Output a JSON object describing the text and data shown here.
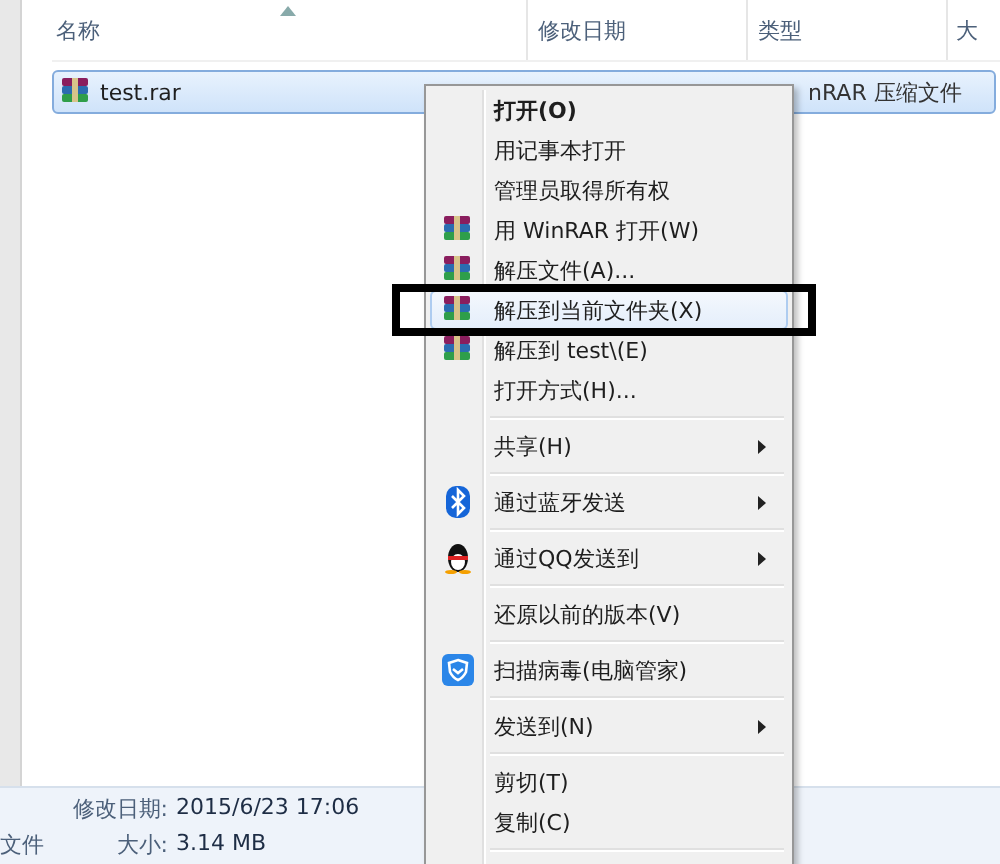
{
  "columns": [
    {
      "label": "名称",
      "sorted": true
    },
    {
      "label": "修改日期",
      "sorted": false
    },
    {
      "label": "类型",
      "sorted": false
    },
    {
      "label": "大",
      "sorted": false
    }
  ],
  "files": [
    {
      "name": "test.rar",
      "type": "nRAR 压缩文件",
      "selected": true
    }
  ],
  "context_menu": [
    {
      "kind": "item",
      "label": "打开(O)",
      "bold": true,
      "submenu": false,
      "selected": false
    },
    {
      "kind": "item",
      "label": "用记事本打开",
      "bold": false,
      "submenu": false,
      "selected": false
    },
    {
      "kind": "item",
      "label": "管理员取得所有权",
      "bold": false,
      "submenu": false,
      "selected": false
    },
    {
      "kind": "winrar",
      "label": "用 WinRAR 打开(W)",
      "bold": false,
      "submenu": false,
      "selected": false
    },
    {
      "kind": "winrar",
      "label": "解压文件(A)...",
      "bold": false,
      "submenu": false,
      "selected": false
    },
    {
      "kind": "winrar",
      "label": "解压到当前文件夹(X)",
      "bold": false,
      "submenu": false,
      "selected": true
    },
    {
      "kind": "winrar",
      "label": "解压到 test\\(E)",
      "bold": false,
      "submenu": false,
      "selected": false
    },
    {
      "kind": "item",
      "label": "打开方式(H)...",
      "bold": false,
      "submenu": false,
      "selected": false
    },
    {
      "kind": "separator"
    },
    {
      "kind": "item",
      "label": "共享(H)",
      "bold": false,
      "submenu": true,
      "selected": false
    },
    {
      "kind": "separator"
    },
    {
      "kind": "bluetooth",
      "label": "通过蓝牙发送",
      "bold": false,
      "submenu": true,
      "selected": false
    },
    {
      "kind": "separator"
    },
    {
      "kind": "qq",
      "label": "通过QQ发送到",
      "bold": false,
      "submenu": true,
      "selected": false
    },
    {
      "kind": "separator"
    },
    {
      "kind": "item",
      "label": "还原以前的版本(V)",
      "bold": false,
      "submenu": false,
      "selected": false
    },
    {
      "kind": "separator"
    },
    {
      "kind": "shield",
      "label": "扫描病毒(电脑管家)",
      "bold": false,
      "submenu": false,
      "selected": false
    },
    {
      "kind": "separator"
    },
    {
      "kind": "item",
      "label": "发送到(N)",
      "bold": false,
      "submenu": true,
      "selected": false
    },
    {
      "kind": "separator"
    },
    {
      "kind": "item",
      "label": "剪切(T)",
      "bold": false,
      "submenu": false,
      "selected": false
    },
    {
      "kind": "item",
      "label": "复制(C)",
      "bold": false,
      "submenu": false,
      "selected": false
    },
    {
      "kind": "separator"
    }
  ],
  "status_bar": {
    "type_fragment": "文件",
    "modified_label": "修改日期:",
    "modified": "2015/6/23 17:06",
    "size_label": "大小:",
    "size": "3.14 MB"
  }
}
